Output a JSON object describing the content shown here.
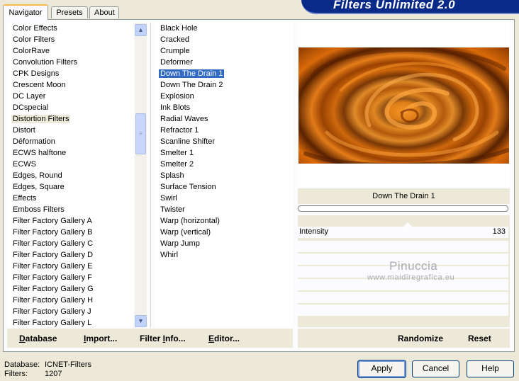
{
  "tabs": [
    "Navigator",
    "Presets",
    "About"
  ],
  "active_tab": 0,
  "banner_title": "Filters Unlimited 2.0",
  "categories": [
    "Color Effects",
    "Color Filters",
    "ColorRave",
    "Convolution Filters",
    "CPK Designs",
    "Crescent Moon",
    "DC Layer",
    "DCspecial",
    "Distortion Filters",
    "Distort",
    "Déformation",
    "ECWS halftone",
    "ECWS",
    "Edges, Round",
    "Edges, Square",
    "Effects",
    "Emboss Filters",
    "Filter Factory Gallery A",
    "Filter Factory Gallery B",
    "Filter Factory Gallery C",
    "Filter Factory Gallery D",
    "Filter Factory Gallery E",
    "Filter Factory Gallery F",
    "Filter Factory Gallery G",
    "Filter Factory Gallery H",
    "Filter Factory Gallery J",
    "Filter Factory Gallery L"
  ],
  "selected_category": "Distortion Filters",
  "filters": [
    "Black Hole",
    "Cracked",
    "Crumple",
    "Deformer",
    "Down The Drain 1",
    "Down The Drain 2",
    "Explosion",
    "Ink Blots",
    "Radial Waves",
    "Refractor 1",
    "Scanline Shifter",
    "Smelter 1",
    "Smelter 2",
    "Splash",
    "Surface Tension",
    "Swirl",
    "Twister",
    "Warp (horizontal)",
    "Warp (vertical)",
    "Warp Jump",
    "Whirl"
  ],
  "selected_filter": "Down The Drain 1",
  "preview_filter_name": "Down The Drain 1",
  "parameter": {
    "label": "Intensity",
    "value": "133"
  },
  "watermark": {
    "line1": "Pinuccia",
    "line2": "www.maidiregrafica.eu"
  },
  "left_buttons": [
    {
      "label": "Database",
      "underline": "D",
      "rest": "atabase"
    },
    {
      "label": "Import...",
      "underline": "I",
      "rest": "mport..."
    },
    {
      "label": "Filter Info...",
      "prefix": "Filter ",
      "underline": "I",
      "rest": "nfo..."
    },
    {
      "label": "Editor...",
      "underline": "E",
      "rest": "ditor..."
    }
  ],
  "right_buttons": {
    "randomize": "Randomize",
    "reset": "Reset"
  },
  "footer": {
    "database_label": "Database:",
    "database_value": "ICNET-Filters",
    "filters_label": "Filters:",
    "filters_value": "1207"
  },
  "dialog_buttons": {
    "apply": "Apply",
    "cancel": "Cancel",
    "help": "Help"
  }
}
